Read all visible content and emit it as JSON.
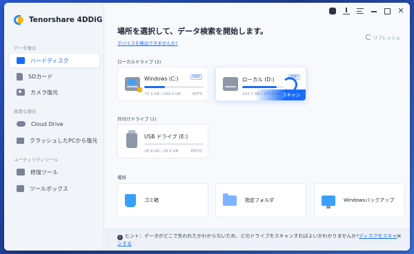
{
  "app": {
    "name": "Tenorshare 4DDiG"
  },
  "sidebar": {
    "sections": [
      {
        "label": "データ復元"
      },
      {
        "label": "高度な復元"
      },
      {
        "label": "ユーティリティツール"
      }
    ],
    "items": [
      {
        "label": "ハードディスク",
        "icon": "hard-disk-icon"
      },
      {
        "label": "SDカード",
        "icon": "sd-card-icon"
      },
      {
        "label": "カメラ復元",
        "icon": "camera-icon"
      },
      {
        "label": "Cloud Drive",
        "icon": "cloud-icon"
      },
      {
        "label": "クラッシュしたPCから復元",
        "icon": "pc-icon"
      },
      {
        "label": "修復ツール",
        "icon": "repair-tool-icon"
      },
      {
        "label": "ツールボックス",
        "icon": "toolbox-icon"
      }
    ],
    "active_index": 0
  },
  "main": {
    "title": "場所を選択して、データ検索を開始します。",
    "help_link": "デバイスを検出できませんか?",
    "refresh_label": "リフレッシュ",
    "local_label": "ローカルドライブ (2)",
    "external_label": "外付けドライブ (1)",
    "locations_label": "場所",
    "local_drives": [
      {
        "name": "Windows (C:)",
        "badge": "SSD",
        "used": "70.3 GB",
        "total": "199.3 GB",
        "size_text": "70.3 GB / 199.3 GB",
        "fs": "NTFS",
        "usage": 0.35
      },
      {
        "name": "ローカル (D:)",
        "badge": "SSD",
        "size_text": "233.7 GB / 276.6 GB",
        "usage": 0.84,
        "scan_label": "スキャン"
      }
    ],
    "external_drives": [
      {
        "name": "USB ドライブ (E:)",
        "size_text": "28.9 GB / 28.9 GB",
        "fs": "FAT32",
        "usage": 0.0
      }
    ],
    "locations": [
      {
        "label": "ゴミ箱",
        "icon": "trash-icon"
      },
      {
        "label": "指定フォルダ",
        "icon": "folder-icon"
      },
      {
        "label": "Windowsバックアップ",
        "icon": "windows-backup-icon"
      }
    ]
  },
  "hint": {
    "prefix": "ヒント：",
    "text": "データがどこで失われたかわからないため、どのドライブをスキャンすればよいかわかりませんか?",
    "link": "ディスクをスキャンする"
  }
}
